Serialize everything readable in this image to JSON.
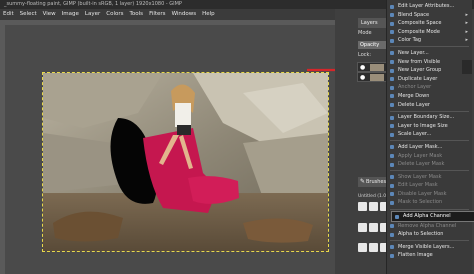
{
  "window": {
    "title": "_summy-floating paint, GIMP (built-in sRGB, 1 layer) 1920x1080 - GIMP",
    "controls": [
      "–",
      "□",
      "✕"
    ]
  },
  "menubar": {
    "items": [
      "Edit",
      "Select",
      "View",
      "Image",
      "Layer",
      "Colors",
      "Tools",
      "Filters",
      "Windows",
      "Help"
    ]
  },
  "layers_panel": {
    "tab_label": "Layers",
    "mode_label": "Mode",
    "opacity_label": "Opacity",
    "lock_label": "Lock:",
    "layers": [
      {
        "visible_icon": "●"
      },
      {
        "visible_icon": "●"
      }
    ]
  },
  "brushes_panel": {
    "tab_label": "Brushes",
    "filter_text": "Untitled (1.0)"
  },
  "context_menu": {
    "items": [
      {
        "label": "Edit Layer Attributes...",
        "disabled": false,
        "submenu": false
      },
      {
        "label": "Blend Space",
        "disabled": false,
        "submenu": true
      },
      {
        "label": "Composite Space",
        "disabled": false,
        "submenu": true
      },
      {
        "label": "Composite Mode",
        "disabled": false,
        "submenu": true
      },
      {
        "label": "Color Tag",
        "disabled": false,
        "submenu": true
      },
      {
        "sep": true
      },
      {
        "label": "New Layer...",
        "disabled": false
      },
      {
        "label": "New from Visible",
        "disabled": false
      },
      {
        "label": "New Layer Group",
        "disabled": false
      },
      {
        "label": "Duplicate Layer",
        "disabled": false
      },
      {
        "label": "Anchor Layer",
        "disabled": true
      },
      {
        "label": "Merge Down",
        "disabled": false
      },
      {
        "label": "Delete Layer",
        "disabled": false
      },
      {
        "sep": true
      },
      {
        "label": "Layer Boundary Size...",
        "disabled": false
      },
      {
        "label": "Layer to Image Size",
        "disabled": false
      },
      {
        "label": "Scale Layer...",
        "disabled": false
      },
      {
        "sep": true
      },
      {
        "label": "Add Layer Mask...",
        "disabled": false
      },
      {
        "label": "Apply Layer Mask",
        "disabled": true
      },
      {
        "label": "Delete Layer Mask",
        "disabled": true
      },
      {
        "sep": true
      },
      {
        "label": "Show Layer Mask",
        "disabled": true
      },
      {
        "label": "Edit Layer Mask",
        "disabled": true
      },
      {
        "label": "Disable Layer Mask",
        "disabled": true
      },
      {
        "label": "Mask to Selection",
        "disabled": true
      },
      {
        "sep": true
      },
      {
        "label": "Add Alpha Channel",
        "disabled": false,
        "highlight": true
      },
      {
        "label": "Remove Alpha Channel",
        "disabled": true
      },
      {
        "label": "Alpha to Selection",
        "disabled": false
      },
      {
        "sep": true
      },
      {
        "label": "Merge Visible Layers...",
        "disabled": false
      },
      {
        "label": "Flatten Image",
        "disabled": false
      }
    ]
  },
  "colors": {
    "arrow": "#d6262a",
    "arrow_blue": "#2f8fdc",
    "highlight": "#1c1c1c"
  }
}
